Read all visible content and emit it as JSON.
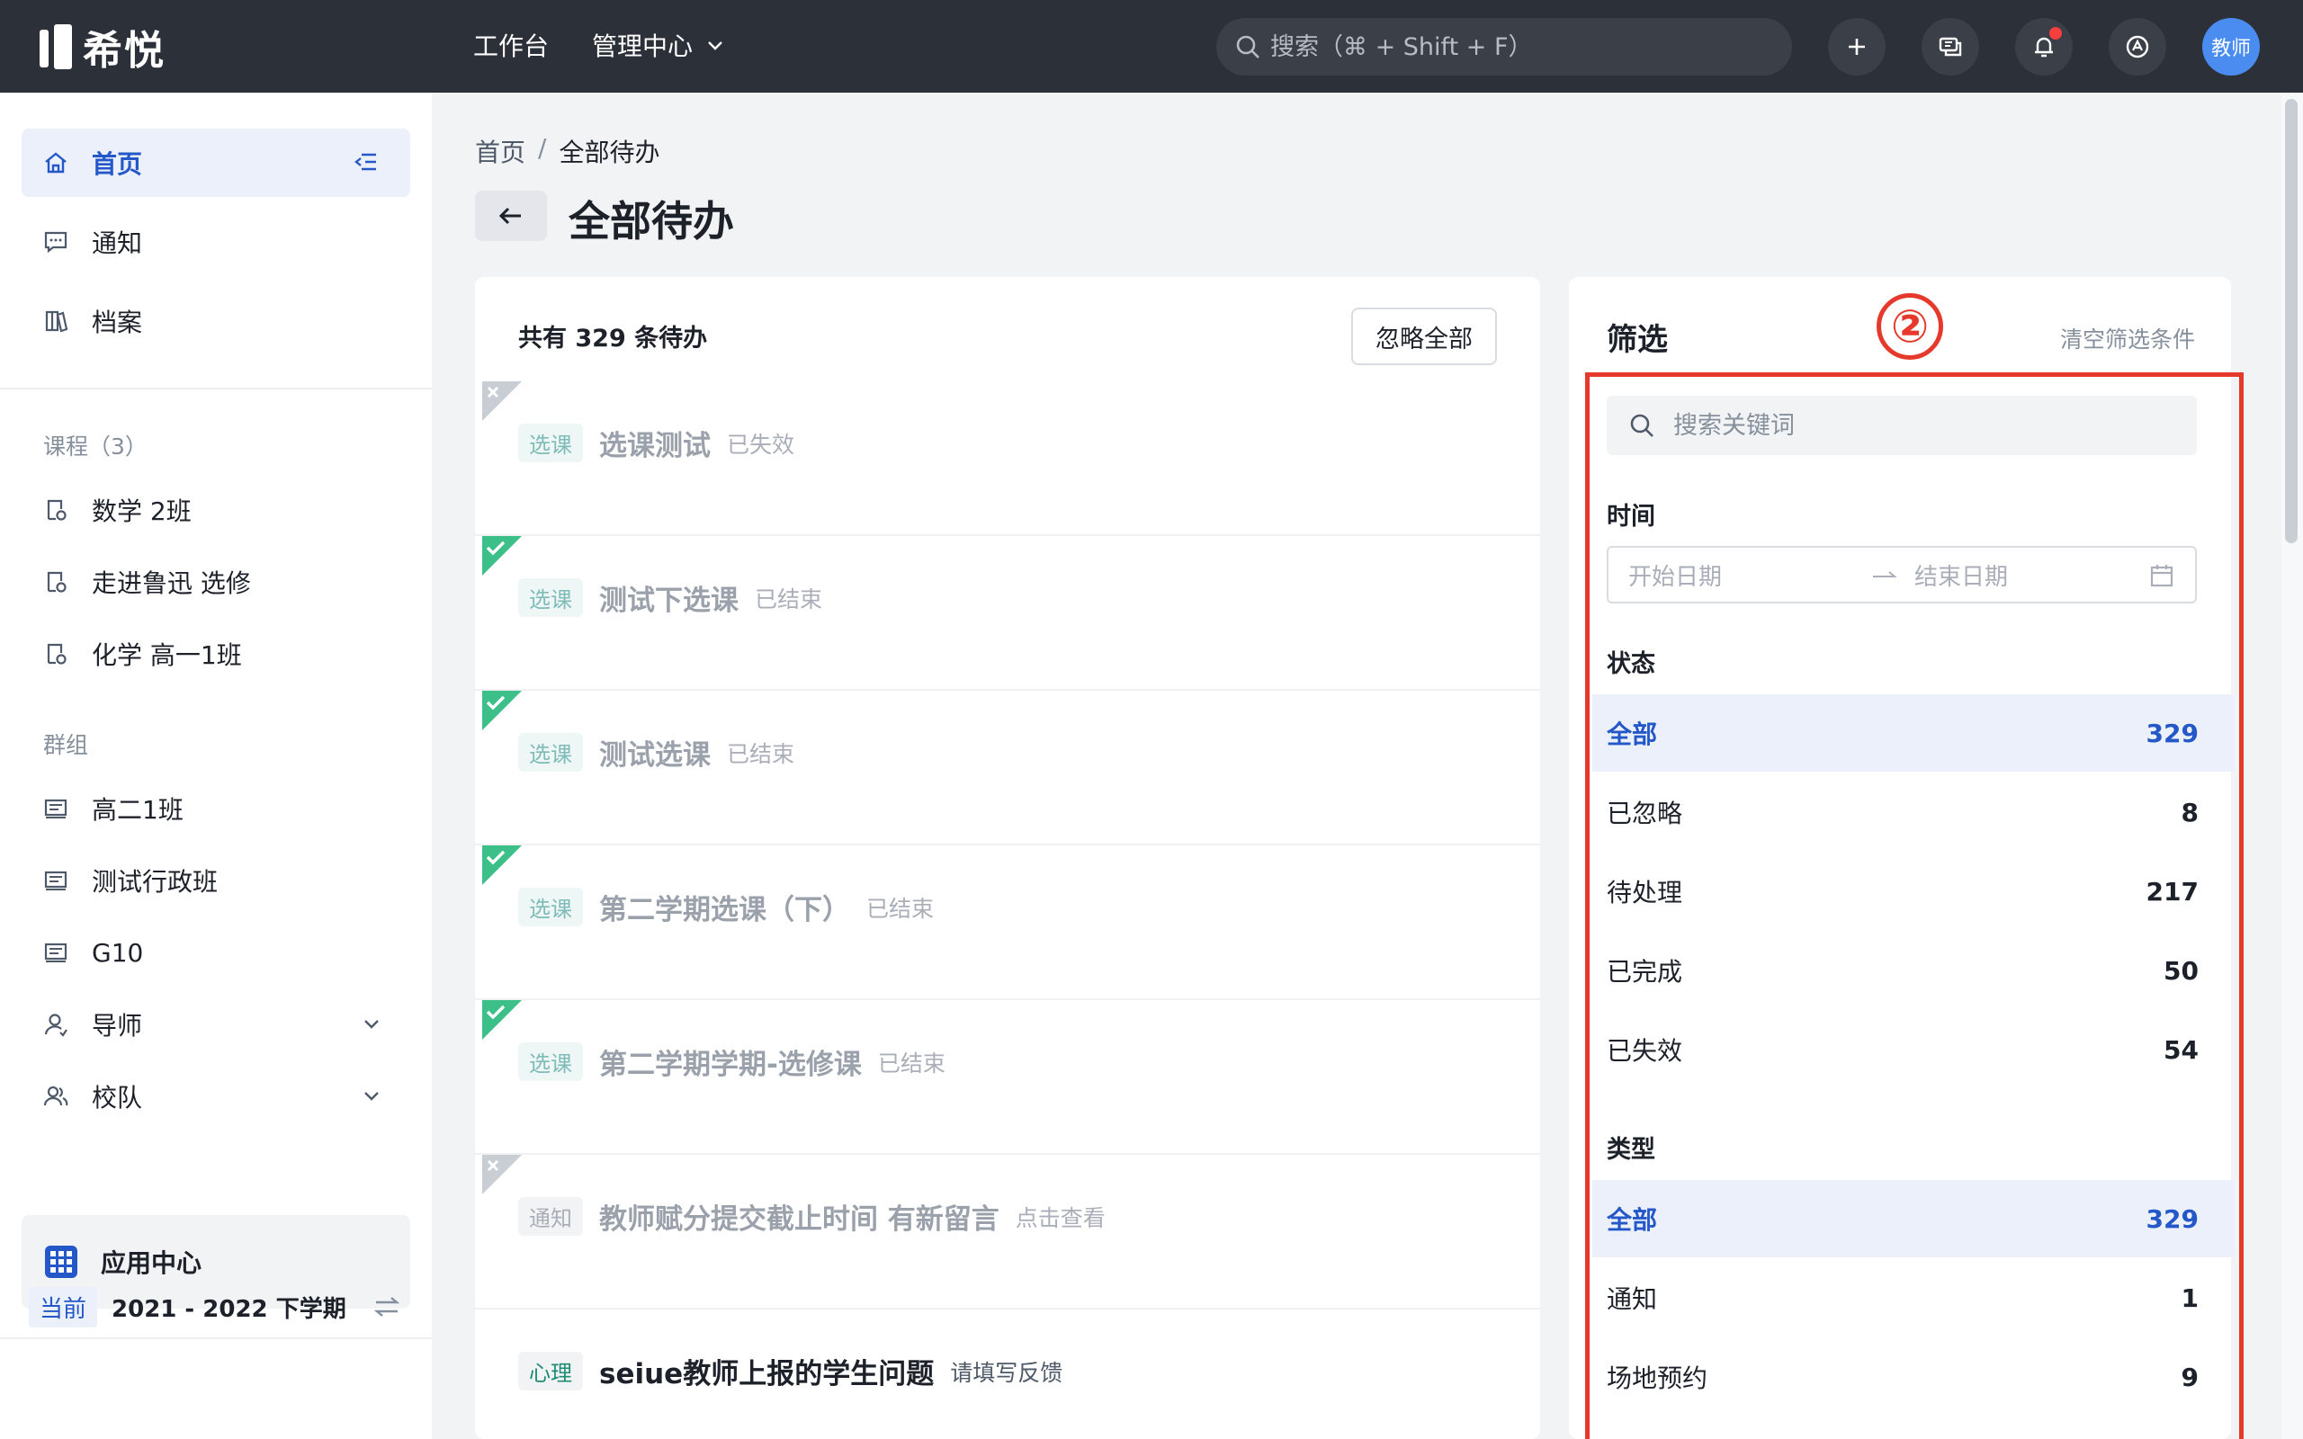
{
  "topbar": {
    "logo_text": "希悦",
    "nav": [
      {
        "label": "工作台"
      },
      {
        "label": "管理中心"
      }
    ],
    "search_placeholder": "搜索（⌘ + Shift + F）",
    "avatar_label": "教师"
  },
  "sidebar": {
    "home": "首页",
    "notice": "通知",
    "archive": "档案",
    "courses_header": "课程（3）",
    "courses": [
      "数学 2班",
      "走进鲁迅 选修",
      "化学 高一1班"
    ],
    "groups_header": "群组",
    "groups": [
      "高二1班",
      "测试行政班",
      "G10"
    ],
    "mentor": "导师",
    "team": "校队",
    "app_center": "应用中心",
    "term_badge": "当前",
    "term": "2021 - 2022 下学期"
  },
  "main": {
    "breadcrumb": [
      "首页",
      "/",
      "全部待办"
    ],
    "title": "全部待办",
    "count_text": "共有 329 条待办",
    "ignore_all": "忽略全部",
    "rows": [
      {
        "tag": "选课",
        "title": "选课测试",
        "status": "已失效",
        "corner": "x"
      },
      {
        "tag": "选课",
        "title": "测试下选课",
        "status": "已结束",
        "corner": "check"
      },
      {
        "tag": "选课",
        "title": "测试选课",
        "status": "已结束",
        "corner": "check"
      },
      {
        "tag": "选课",
        "title": "第二学期选课（下）",
        "status": "已结束",
        "corner": "check"
      },
      {
        "tag": "选课",
        "title": "第二学期学期-选修课",
        "status": "已结束",
        "corner": "check"
      },
      {
        "tag": "通知",
        "title": "教师赋分提交截止时间 有新留言",
        "status": "点击查看",
        "corner": "x"
      },
      {
        "tag": "心理",
        "title": "seiue教师上报的学生问题",
        "status": "请填写反馈",
        "corner": "none"
      }
    ]
  },
  "filter": {
    "title": "筛选",
    "clear": "清空筛选条件",
    "annotation": "②",
    "search_placeholder": "搜索关键词",
    "time_label": "时间",
    "start_placeholder": "开始日期",
    "end_placeholder": "结束日期",
    "status_label": "状态",
    "status_options": [
      {
        "label": "全部",
        "count": "329",
        "active": true
      },
      {
        "label": "已忽略",
        "count": "8"
      },
      {
        "label": "待处理",
        "count": "217"
      },
      {
        "label": "已完成",
        "count": "50"
      },
      {
        "label": "已失效",
        "count": "54"
      }
    ],
    "type_label": "类型",
    "type_options": [
      {
        "label": "全部",
        "count": "329",
        "active": true
      },
      {
        "label": "通知",
        "count": "1"
      },
      {
        "label": "场地预约",
        "count": "9"
      }
    ]
  },
  "colors": {
    "topbar": "#2c3038",
    "accent": "#2458c8",
    "active_bg": "#ebf0fa",
    "check_green": "#3dbf8a",
    "annotation_red": "#e53a2b"
  }
}
